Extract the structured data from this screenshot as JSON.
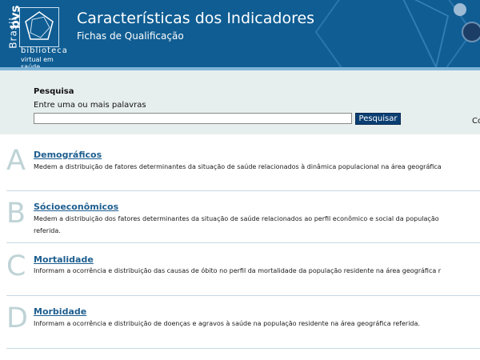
{
  "header": {
    "title": "Características dos Indicadores",
    "subtitle": "Fichas de Qualificação",
    "logo": {
      "country": "Brasil",
      "acronym": "bvs",
      "line1": "biblioteca",
      "line2": "virtual em saúde"
    },
    "colors": {
      "background": "#0f5d93",
      "accent": "#7fb4d8"
    }
  },
  "search": {
    "title": "Pesquisa",
    "hint": "Entre uma ou mais palavras",
    "value": "",
    "button": "Pesquisar",
    "edge_text": "Co"
  },
  "categories": [
    {
      "letter": "A",
      "title": "Demográficos",
      "desc1": "Medem a distribuição de fatores determinantes da situação de saúde relacionados à dinâmica populacional na área geográfica",
      "desc2": ""
    },
    {
      "letter": "B",
      "title": "Sócioeconômicos",
      "desc1": "Medem a distribuição dos fatores determinantes da situação de saúde relacionados ao perfil econômico e social da população",
      "desc2": "referida."
    },
    {
      "letter": "C",
      "title": "Mortalidade",
      "desc1": "Informam a ocorrência e distribuição das causas de óbito no perfil da mortalidade da população residente na área geográfica r",
      "desc2": ""
    },
    {
      "letter": "D",
      "title": "Morbidade",
      "desc1": "Informam a ocorrência e distribuição de doenças e agravos à saúde na população residente na área geográfica referida.",
      "desc2": ""
    }
  ]
}
